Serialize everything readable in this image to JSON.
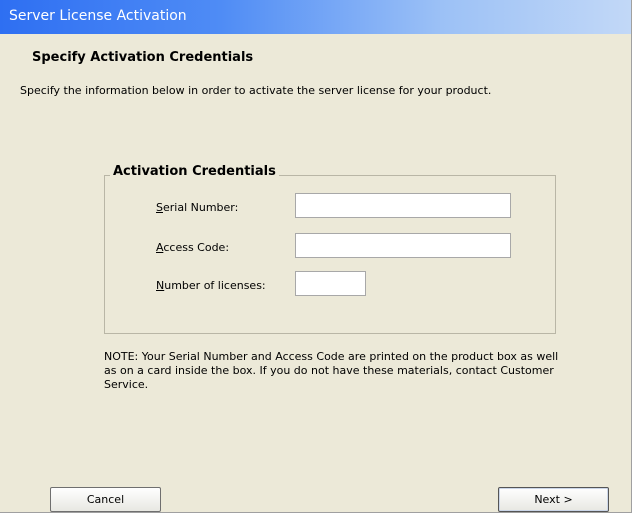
{
  "window": {
    "title": "Server License Activation"
  },
  "header": {
    "heading": "Specify Activation Credentials",
    "description": "Specify the information below in order to activate the server license for your product."
  },
  "group": {
    "title": "Activation Credentials",
    "fields": [
      {
        "label_access_key": "S",
        "label_rest": "erial Number:",
        "value": ""
      },
      {
        "label_access_key": "A",
        "label_rest": "ccess Code:",
        "value": ""
      },
      {
        "label_access_key": "N",
        "label_rest": "umber of licenses:",
        "value": ""
      }
    ]
  },
  "note": "NOTE:  Your Serial Number and Access Code are printed on the product box as well as on a card inside the box.  If you do not have these materials, contact Customer Service.",
  "buttons": {
    "cancel": "Cancel",
    "next": "Next >"
  }
}
